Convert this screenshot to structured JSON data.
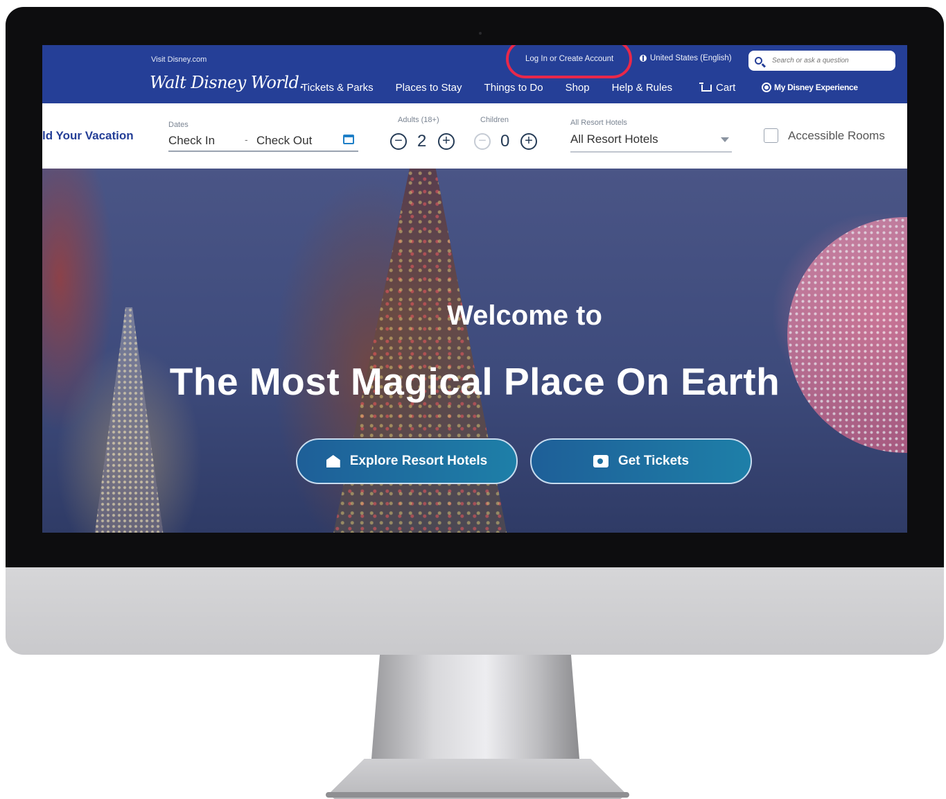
{
  "header": {
    "visit_link": "Visit Disney.com",
    "logo_text": "Walt Disney World.",
    "login_link": "Log In or Create Account",
    "locale": "United States (English)",
    "search_placeholder": "Search or ask a question",
    "nav": [
      "Tickets & Parks",
      "Places to Stay",
      "Things to Do",
      "Shop",
      "Help & Rules"
    ],
    "cart": "Cart",
    "my_disney_experience": "My Disney Experience"
  },
  "booking": {
    "title": "ld Your Vacation",
    "dates_label": "Dates",
    "check_in": "Check In",
    "separator": "-",
    "check_out": "Check Out",
    "adults_label": "Adults (18+)",
    "adults_value": "2",
    "children_label": "Children",
    "children_value": "0",
    "resort_label": "All Resort Hotels",
    "resort_value": "All Resort Hotels",
    "accessible_rooms": "Accessible Rooms"
  },
  "hero": {
    "welcome": "Welcome to",
    "headline": "The Most Magical Place On Earth",
    "button_hotels": "Explore Resort Hotels",
    "button_tickets": "Get Tickets"
  },
  "colors": {
    "nav_blue": "#253f97",
    "highlight_red": "#e8284a",
    "button_blue": "#1e6f9f"
  }
}
